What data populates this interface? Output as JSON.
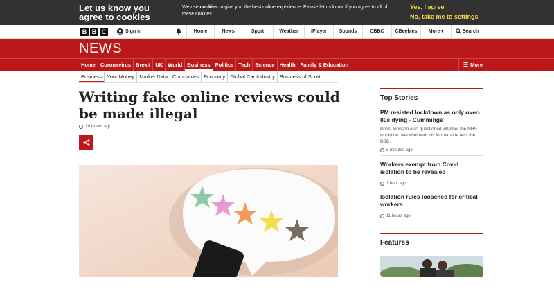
{
  "cookie": {
    "title": "Let us know you agree to cookies",
    "message_pre": "We use ",
    "message_bold": "cookies",
    "message_post": " to give you the best online experience. Please let us know if you agree to all of these cookies.",
    "yes_label": "Yes, I agree",
    "no_label": "No, take me to settings"
  },
  "topnav": {
    "logo_letters": [
      "B",
      "B",
      "C"
    ],
    "sign_in": "Sign in",
    "items": [
      "Home",
      "News",
      "Sport",
      "Weather",
      "iPlayer",
      "Sounds",
      "CBBC",
      "CBeebies",
      "More",
      "Search"
    ]
  },
  "news": {
    "logo": "NEWS",
    "sections": [
      "Home",
      "Coronavirus",
      "Brexit",
      "UK",
      "World",
      "Business",
      "Politics",
      "Tech",
      "Science",
      "Health",
      "Family & Education"
    ],
    "active_section": "Business",
    "more_label": "More",
    "subnav": [
      "Business",
      "Your Money",
      "Market Data",
      "Companies",
      "Economy",
      "Global Car Industry",
      "Business of Sport"
    ]
  },
  "article": {
    "headline": "Writing fake online reviews could be made illegal",
    "time": "10 hours ago"
  },
  "sidebar": {
    "top_stories_title": "Top Stories",
    "stories": [
      {
        "headline": "PM resisted lockdown as only over-80s dying - Cummings",
        "summary": "Boris Johnson also questioned whether the NHS would be overwhelmed, his former aide tells the BBC.",
        "time": "8 minutes ago"
      },
      {
        "headline": "Workers exempt from Covid isolation to be revealed",
        "summary": "",
        "time": "1 hour ago"
      },
      {
        "headline": "Isolation rules loosened for critical workers",
        "summary": "",
        "time": "11 hours ago"
      }
    ],
    "features_title": "Features"
  },
  "colors": {
    "brand_red": "#bb1919",
    "cookie_bg": "#323232",
    "cookie_accent": "#fdd44b"
  }
}
